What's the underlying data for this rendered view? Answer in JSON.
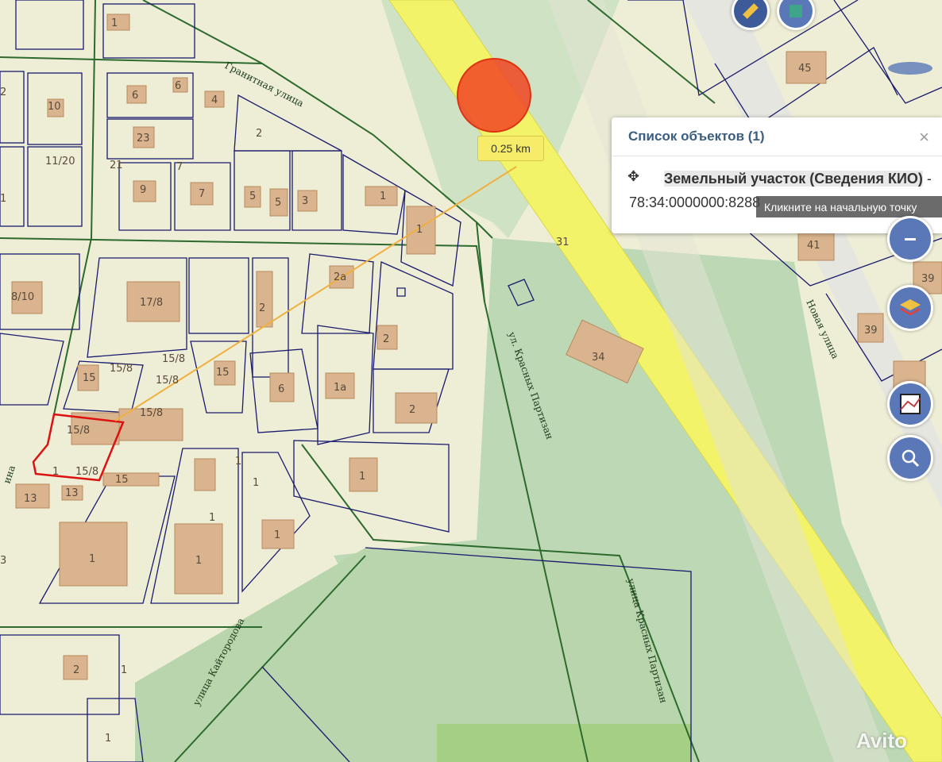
{
  "map": {
    "measure_distance": "0.25 km",
    "street_labels": {
      "granitnaya": "Гранитная улица",
      "krasnykh_partizan_upper": "ул. Красных Партизан",
      "krasnykh_partizan_lower": "улица Красных Партизан",
      "kaitorodova": "улица Кайтородова",
      "novaya": "Новая улица",
      "left_edge": "ина"
    },
    "parcel_labels": [
      "1",
      "6",
      "6",
      "4",
      "23",
      "21",
      "7",
      "9",
      "7",
      "5",
      "5",
      "3",
      "1",
      "1",
      "2",
      "10",
      "11/20",
      "8/10",
      "17/8",
      "2",
      "2a",
      "2",
      "15",
      "15/8",
      "15/8",
      "15/8",
      "15/8",
      "15",
      "15/8",
      "1",
      "6",
      "1a",
      "2",
      "13",
      "13",
      "15",
      "1",
      "1",
      "1",
      "1",
      "1",
      "1",
      "1",
      "2",
      "34",
      "31",
      "45",
      "41",
      "39",
      "39",
      "1",
      "1",
      "1",
      "3",
      "2",
      "15/8"
    ]
  },
  "popup": {
    "title": "Список объектов (1)",
    "close": "×",
    "object_type": "Земельный участок (Сведения КИО)",
    "separator": " - ",
    "cadastral_number": "78:34:0000000:8288"
  },
  "hint": "Кликните на начальную точку",
  "watermark": "Avito",
  "colors": {
    "road": "#f3f36a",
    "parcel_line": "#1a1a6e",
    "boundary_green": "#2d6a2d",
    "building": "#d9b48e",
    "selected": "#dd1111",
    "marker": "#ee4422"
  },
  "controls": [
    "ruler-icon",
    "square-tool-icon",
    "layers-icon",
    "map-layers-icon",
    "search-icon"
  ]
}
